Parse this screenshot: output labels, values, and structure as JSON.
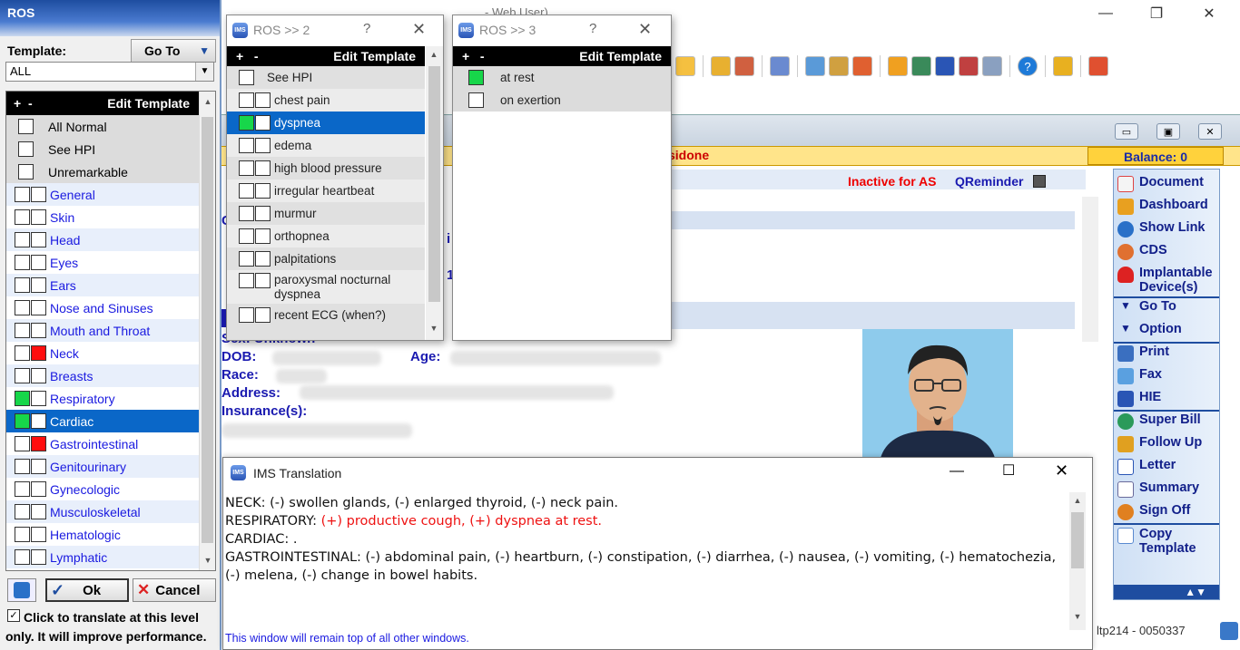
{
  "main": {
    "caption": "- Web User)",
    "balance": "Balance: 0",
    "sidone_text": "sidone",
    "inactive_text": "Inactive for AS",
    "qreminder": "QReminder",
    "patient_labels": {
      "sex": "Sex:  Unknown",
      "dob": "DOB:",
      "age": "Age:",
      "race": "Race:",
      "address": "Address:",
      "insurance": "Insurance(s):"
    },
    "side_fragments": [
      "C",
      "i",
      "1"
    ],
    "status_right": "ltp214 - 0050337"
  },
  "right_menu": [
    {
      "label": "Document",
      "icon": "document-icon",
      "color": "#d44"
    },
    {
      "label": "Dashboard",
      "icon": "dashboard-icon",
      "color": "#e8a020"
    },
    {
      "label": "Show Link",
      "icon": "link-icon",
      "color": "#2a70c8"
    },
    {
      "label": "CDS",
      "icon": "cds-icon",
      "color": "#e07030"
    },
    {
      "label": "Implantable Device(s)",
      "icon": "heart-icon",
      "color": "#d22"
    },
    {
      "label": "Go To",
      "icon": "triangle-down-icon",
      "color": "#12208a"
    },
    {
      "label": "Option",
      "icon": "triangle-down-icon",
      "color": "#12208a"
    },
    {
      "label": "Print",
      "icon": "print-icon",
      "color": "#3a6fc0"
    },
    {
      "label": "Fax",
      "icon": "fax-icon",
      "color": "#5aa0e0"
    },
    {
      "label": "HIE",
      "icon": "hie-icon",
      "color": "#2a55b5"
    },
    {
      "label": "Super Bill",
      "icon": "superbill-icon",
      "color": "#2a9a5a"
    },
    {
      "label": "Follow Up",
      "icon": "calendar-icon",
      "color": "#e0a020"
    },
    {
      "label": "Letter",
      "icon": "letter-icon",
      "color": "#2a55b5"
    },
    {
      "label": "Summary",
      "icon": "summary-icon",
      "color": "#6a6a9a"
    },
    {
      "label": "Sign Off",
      "icon": "signoff-icon",
      "color": "#e08020"
    },
    {
      "label": "Copy Template",
      "icon": "copy-icon",
      "color": "#5a8ad0"
    }
  ],
  "ros": {
    "title": "ROS",
    "template_label": "Template:",
    "goto_label": "Go To",
    "template_value": "ALL",
    "header_plus": "+",
    "header_minus": "-",
    "edit_template": "Edit Template",
    "top_items": [
      {
        "label": "All Normal",
        "state": ""
      },
      {
        "label": "See HPI",
        "state": ""
      },
      {
        "label": "Unremarkable",
        "state": ""
      }
    ],
    "systems": [
      {
        "label": "General",
        "a": "",
        "b": ""
      },
      {
        "label": "Skin",
        "a": "",
        "b": ""
      },
      {
        "label": "Head",
        "a": "",
        "b": ""
      },
      {
        "label": "Eyes",
        "a": "",
        "b": ""
      },
      {
        "label": "Ears",
        "a": "",
        "b": ""
      },
      {
        "label": "Nose and Sinuses",
        "a": "",
        "b": ""
      },
      {
        "label": "Mouth and Throat",
        "a": "",
        "b": ""
      },
      {
        "label": "Neck",
        "a": "",
        "b": "red"
      },
      {
        "label": "Breasts",
        "a": "",
        "b": ""
      },
      {
        "label": "Respiratory",
        "a": "green",
        "b": ""
      },
      {
        "label": "Cardiac",
        "a": "green",
        "b": "",
        "selected": true
      },
      {
        "label": "Gastrointestinal",
        "a": "",
        "b": "red"
      },
      {
        "label": "Genitourinary",
        "a": "",
        "b": ""
      },
      {
        "label": "Gynecologic",
        "a": "",
        "b": ""
      },
      {
        "label": "Musculoskeletal",
        "a": "",
        "b": ""
      },
      {
        "label": "Hematologic",
        "a": "",
        "b": ""
      },
      {
        "label": "Lymphatic",
        "a": "",
        "b": ""
      }
    ],
    "ok_label": "Ok",
    "cancel_label": "Cancel",
    "click_text": "Click to translate at this level only. It will improve performance."
  },
  "ros2": {
    "title": "ROS >> 2",
    "help": "?",
    "edit_template": "Edit Template",
    "items": [
      {
        "label": "See HPI",
        "single": true
      },
      {
        "label": "chest pain"
      },
      {
        "label": "dyspnea",
        "a": "green",
        "selected": true
      },
      {
        "label": "edema"
      },
      {
        "label": "high blood pressure"
      },
      {
        "label": "irregular heartbeat"
      },
      {
        "label": "murmur"
      },
      {
        "label": "orthopnea"
      },
      {
        "label": "palpitations"
      },
      {
        "label": "paroxysmal nocturnal dyspnea"
      },
      {
        "label": "recent ECG (when?)"
      }
    ]
  },
  "ros3": {
    "title": "ROS >> 3",
    "help": "?",
    "edit_template": "Edit Template",
    "items": [
      {
        "label": "at rest",
        "a": "green"
      },
      {
        "label": "on exertion"
      }
    ]
  },
  "translation": {
    "title": "IMS Translation",
    "neck": "NECK: (-) swollen glands, (-) enlarged thyroid, (-) neck pain.",
    "resp_prefix": "RESPIRATORY: ",
    "resp_positive": "(+) productive cough, (+) dyspnea at rest.",
    "cardiac": "CARDIAC: .",
    "gi": "GASTROINTESTINAL: (-) abdominal pain, (-) heartburn, (-) constipation, (-) diarrhea, (-) nausea, (-) vomiting, (-) hematochezia, (-) melena, (-) change in bowel habits.",
    "note": "This window will remain top of all other windows."
  }
}
